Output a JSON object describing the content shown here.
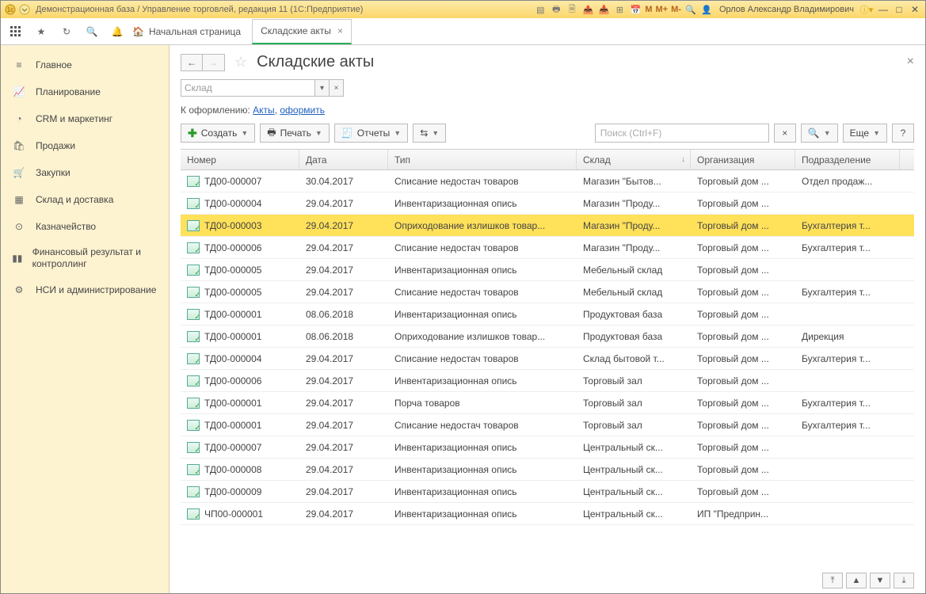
{
  "titlebar": {
    "title": "Демонстрационная база / Управление торговлей, редакция 11  (1С:Предприятие)",
    "user": "Орлов Александр Владимирович",
    "m": "M",
    "mPlus": "M+",
    "mMinus": "M-"
  },
  "nav": {
    "home": "Начальная страница",
    "tab": "Складские акты"
  },
  "sidebar": [
    {
      "icon": "home",
      "label": "Главное"
    },
    {
      "icon": "chart",
      "label": "Планирование"
    },
    {
      "icon": "pie",
      "label": "CRM и маркетинг"
    },
    {
      "icon": "bag",
      "label": "Продажи"
    },
    {
      "icon": "cart",
      "label": "Закупки"
    },
    {
      "icon": "boxes",
      "label": "Склад и доставка"
    },
    {
      "icon": "coin",
      "label": "Казначейство"
    },
    {
      "icon": "bars",
      "label": "Финансовый результат и контроллинг"
    },
    {
      "icon": "gear",
      "label": "НСИ и администрирование"
    }
  ],
  "page": {
    "title": "Складские акты",
    "filter_placeholder": "Склад",
    "linkrow_prefix": "К оформлению:  ",
    "link_acts": "Акты",
    "link_create": "оформить",
    "create": "Создать",
    "print": "Печать",
    "reports": "Отчеты",
    "search_placeholder": "Поиск (Ctrl+F)",
    "more": "Еще"
  },
  "columns": [
    "Номер",
    "Дата",
    "Тип",
    "Склад",
    "Организация",
    "Подразделение"
  ],
  "rows": [
    {
      "num": "ТД00-000007",
      "date": "30.04.2017",
      "type": "Списание недостач товаров",
      "store": "Магазин \"Бытов...",
      "org": "Торговый дом ...",
      "dept": "Отдел продаж...",
      "sel": false
    },
    {
      "num": "ТД00-000004",
      "date": "29.04.2017",
      "type": "Инвентаризационная опись",
      "store": "Магазин \"Проду...",
      "org": "Торговый дом ...",
      "dept": "",
      "sel": false
    },
    {
      "num": "ТД00-000003",
      "date": "29.04.2017",
      "type": "Оприходование излишков товар...",
      "store": "Магазин \"Проду...",
      "org": "Торговый дом ...",
      "dept": "Бухгалтерия т...",
      "sel": true
    },
    {
      "num": "ТД00-000006",
      "date": "29.04.2017",
      "type": "Списание недостач товаров",
      "store": "Магазин \"Проду...",
      "org": "Торговый дом ...",
      "dept": "Бухгалтерия т...",
      "sel": false
    },
    {
      "num": "ТД00-000005",
      "date": "29.04.2017",
      "type": "Инвентаризационная опись",
      "store": "Мебельный склад",
      "org": "Торговый дом ...",
      "dept": "",
      "sel": false
    },
    {
      "num": "ТД00-000005",
      "date": "29.04.2017",
      "type": "Списание недостач товаров",
      "store": "Мебельный склад",
      "org": "Торговый дом ...",
      "dept": "Бухгалтерия т...",
      "sel": false
    },
    {
      "num": "ТД00-000001",
      "date": "08.06.2018",
      "type": "Инвентаризационная опись",
      "store": "Продуктовая база",
      "org": "Торговый дом ...",
      "dept": "",
      "sel": false
    },
    {
      "num": "ТД00-000001",
      "date": "08.06.2018",
      "type": "Оприходование излишков товар...",
      "store": "Продуктовая база",
      "org": "Торговый дом ...",
      "dept": "Дирекция",
      "sel": false
    },
    {
      "num": "ТД00-000004",
      "date": "29.04.2017",
      "type": "Списание недостач товаров",
      "store": "Склад бытовой т...",
      "org": "Торговый дом ...",
      "dept": "Бухгалтерия т...",
      "sel": false
    },
    {
      "num": "ТД00-000006",
      "date": "29.04.2017",
      "type": "Инвентаризационная опись",
      "store": "Торговый зал",
      "org": "Торговый дом ...",
      "dept": "",
      "sel": false
    },
    {
      "num": "ТД00-000001",
      "date": "29.04.2017",
      "type": "Порча товаров",
      "store": "Торговый зал",
      "org": "Торговый дом ...",
      "dept": "Бухгалтерия т...",
      "sel": false
    },
    {
      "num": "ТД00-000001",
      "date": "29.04.2017",
      "type": "Списание недостач товаров",
      "store": "Торговый зал",
      "org": "Торговый дом ...",
      "dept": "Бухгалтерия т...",
      "sel": false
    },
    {
      "num": "ТД00-000007",
      "date": "29.04.2017",
      "type": "Инвентаризационная опись",
      "store": "Центральный ск...",
      "org": "Торговый дом ...",
      "dept": "",
      "sel": false
    },
    {
      "num": "ТД00-000008",
      "date": "29.04.2017",
      "type": "Инвентаризационная опись",
      "store": "Центральный ск...",
      "org": "Торговый дом ...",
      "dept": "",
      "sel": false
    },
    {
      "num": "ТД00-000009",
      "date": "29.04.2017",
      "type": "Инвентаризационная опись",
      "store": "Центральный ск...",
      "org": "Торговый дом ...",
      "dept": "",
      "sel": false
    },
    {
      "num": "ЧП00-000001",
      "date": "29.04.2017",
      "type": "Инвентаризационная опись",
      "store": "Центральный ск...",
      "org": "ИП \"Предприн...",
      "dept": "",
      "sel": false
    }
  ]
}
